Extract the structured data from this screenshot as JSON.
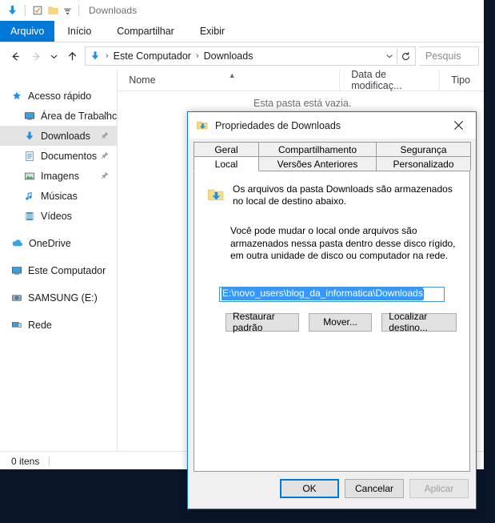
{
  "window": {
    "title": "Downloads",
    "quick_access": [
      "downloads-arrow-icon",
      "properties-icon",
      "new-folder-icon",
      "customize-chevron-icon"
    ]
  },
  "ribbon": {
    "tabs": [
      {
        "label": "Arquivo",
        "active": true
      },
      {
        "label": "Início",
        "active": false
      },
      {
        "label": "Compartilhar",
        "active": false
      },
      {
        "label": "Exibir",
        "active": false
      }
    ]
  },
  "nav": {
    "back_icon": "back-arrow-icon",
    "forward_icon": "forward-arrow-icon",
    "recent_icon": "recent-locations-chevron-icon",
    "up_icon": "up-arrow-icon",
    "breadcrumbs": [
      "Este Computador",
      "Downloads"
    ],
    "dropdown_icon": "address-dropdown-icon",
    "refresh_icon": "refresh-icon",
    "search_placeholder": "Pesquis"
  },
  "sidebar": {
    "items": [
      {
        "label": "Acesso rápido",
        "icon": "star-pin-icon",
        "level": 1,
        "selected": false,
        "pinned": false
      },
      {
        "label": "Área de Trabalhc",
        "icon": "desktop-icon",
        "level": 2,
        "selected": false,
        "pinned": true
      },
      {
        "label": "Downloads",
        "icon": "downloads-arrow-icon",
        "level": 2,
        "selected": true,
        "pinned": true
      },
      {
        "label": "Documentos",
        "icon": "documents-icon",
        "level": 2,
        "selected": false,
        "pinned": true
      },
      {
        "label": "Imagens",
        "icon": "pictures-icon",
        "level": 2,
        "selected": false,
        "pinned": true
      },
      {
        "label": "Músicas",
        "icon": "music-note-icon",
        "level": 2,
        "selected": false,
        "pinned": false
      },
      {
        "label": "Vídeos",
        "icon": "video-film-icon",
        "level": 2,
        "selected": false,
        "pinned": false
      },
      {
        "label": "OneDrive",
        "icon": "onedrive-cloud-icon",
        "level": 1,
        "selected": false,
        "pinned": false
      },
      {
        "label": "Este Computador",
        "icon": "this-pc-icon",
        "level": 1,
        "selected": false,
        "pinned": false
      },
      {
        "label": "SAMSUNG (E:)",
        "icon": "drive-icon",
        "level": 1,
        "selected": false,
        "pinned": false
      },
      {
        "label": "Rede",
        "icon": "network-icon",
        "level": 1,
        "selected": false,
        "pinned": false
      }
    ]
  },
  "file_list": {
    "columns": [
      {
        "label": "Nome",
        "sorted": true
      },
      {
        "label": "Data de modificaç...",
        "sorted": false
      },
      {
        "label": "Tipo",
        "sorted": false
      }
    ],
    "empty_message": "Esta pasta está vazia."
  },
  "status": {
    "item_count": "0 itens"
  },
  "dialog": {
    "title": "Propriedades de Downloads",
    "icon": "downloads-folder-icon",
    "close_label": "✕",
    "tabs_row1": [
      {
        "label": "Geral",
        "active": false
      },
      {
        "label": "Compartilhamento",
        "active": false
      },
      {
        "label": "Segurança",
        "active": false
      }
    ],
    "tabs_row2": [
      {
        "label": "Local",
        "active": true
      },
      {
        "label": "Versões Anteriores",
        "active": false
      },
      {
        "label": "Personalizado",
        "active": false
      }
    ],
    "info_text_line1": "Os arquivos da pasta Downloads são armazenados",
    "info_text_line2": "no local de destino abaixo.",
    "paragraph": "Você pode mudar o local onde arquivos são armazenados nessa pasta dentro desse disco rígido, em outra unidade de disco ou computador na rede.",
    "path_value": "E:\\novo_users\\blog_da_informatica\\Downloads",
    "path_selected": true,
    "buttons": [
      {
        "label": "Restaurar padrão"
      },
      {
        "label": "Mover..."
      },
      {
        "label": "Localizar destino..."
      }
    ],
    "footer_buttons": [
      {
        "label": "OK",
        "style": "default"
      },
      {
        "label": "Cancelar",
        "style": "normal"
      },
      {
        "label": "Aplicar",
        "style": "disabled"
      }
    ]
  },
  "colors": {
    "accent": "#0078d7",
    "selection": "#3399ff",
    "desktop": "#0a1628",
    "dialog_bg": "#f0f0f0"
  }
}
